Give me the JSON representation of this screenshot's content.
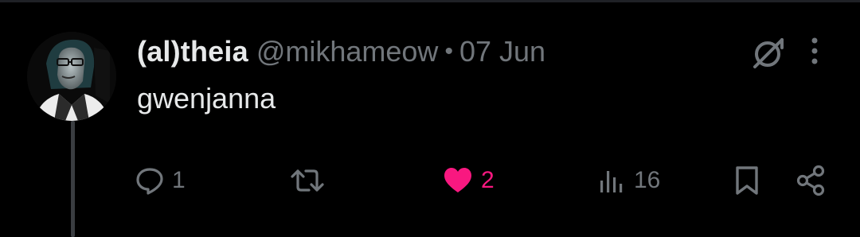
{
  "tweet": {
    "display_name": "(al)theia",
    "handle": "@mikhameow",
    "separator": "•",
    "date": "07 Jun",
    "text": "gwenjanna"
  },
  "actions": {
    "reply": {
      "icon": "reply-icon",
      "count": "1"
    },
    "retweet": {
      "icon": "retweet-icon",
      "count": ""
    },
    "like": {
      "icon": "heart-icon",
      "count": "2",
      "liked": true
    },
    "views": {
      "icon": "views-icon",
      "count": "16"
    },
    "bookmark": {
      "icon": "bookmark-icon"
    },
    "share": {
      "icon": "share-icon"
    }
  },
  "header_icons": [
    "grok-icon",
    "more-icon"
  ],
  "colors": {
    "background": "#000000",
    "text_primary": "#e7e9ea",
    "text_secondary": "#71767b",
    "like_active": "#f91880",
    "thread_line": "#3a3d41"
  }
}
